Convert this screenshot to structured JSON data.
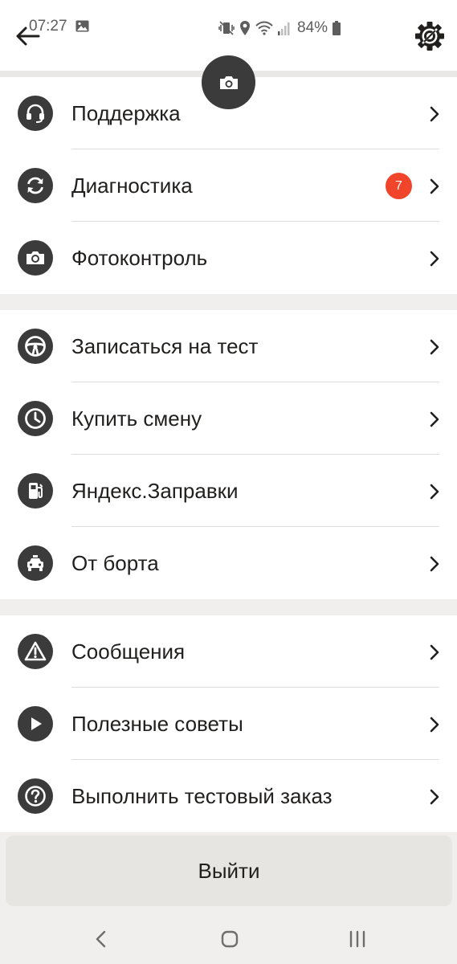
{
  "status_bar": {
    "time": "07:27",
    "battery_percent": "84%"
  },
  "header": {
    "back_icon": "arrow-left-icon",
    "settings_icon": "gear-icon"
  },
  "camera_button_icon": "camera-icon",
  "sections": [
    {
      "items": [
        {
          "label": "Поддержка",
          "icon": "headset-icon"
        },
        {
          "label": "Диагностика",
          "icon": "refresh-icon",
          "badge": "7"
        },
        {
          "label": "Фотоконтроль",
          "icon": "camera-icon"
        }
      ]
    },
    {
      "items": [
        {
          "label": "Записаться на тест",
          "icon": "steering-wheel-icon"
        },
        {
          "label": "Купить смену",
          "icon": "clock-icon"
        },
        {
          "label": "Яндекс.Заправки",
          "icon": "fuel-icon"
        },
        {
          "label": "От борта",
          "icon": "taxi-icon"
        }
      ]
    },
    {
      "items": [
        {
          "label": "Сообщения",
          "icon": "warning-icon"
        },
        {
          "label": "Полезные советы",
          "icon": "play-icon"
        },
        {
          "label": "Выполнить тестовый заказ",
          "icon": "help-icon"
        }
      ]
    }
  ],
  "exit_button": {
    "label": "Выйти"
  },
  "colors": {
    "badge": "#f0452b",
    "icon_circle": "#3b3b3b",
    "section_gap": "#f0efed",
    "exit_button_bg": "#e6e5e1"
  }
}
